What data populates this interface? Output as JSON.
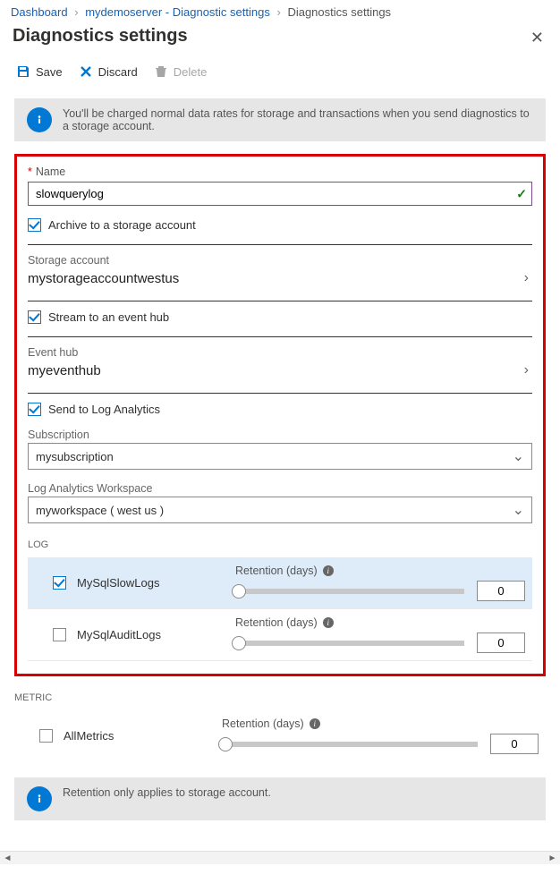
{
  "breadcrumb": {
    "items": [
      "Dashboard",
      "mydemoserver - Diagnostic settings",
      "Diagnostics settings"
    ]
  },
  "page_title": "Diagnostics settings",
  "toolbar": {
    "save": "Save",
    "discard": "Discard",
    "delete": "Delete"
  },
  "info_top": "You'll be charged normal data rates for storage and transactions when you send diagnostics to a storage account.",
  "name_field": {
    "label": "Name",
    "value": "slowquerylog"
  },
  "archive_chk": "Archive to a storage account",
  "storage_account": {
    "label": "Storage account",
    "value": "mystorageaccountwestus"
  },
  "stream_chk": "Stream to an event hub",
  "event_hub": {
    "label": "Event hub",
    "value": "myeventhub"
  },
  "log_analytics_chk": "Send to Log Analytics",
  "subscription": {
    "label": "Subscription",
    "value": "mysubscription"
  },
  "workspace": {
    "label": "Log Analytics Workspace",
    "value": "myworkspace ( west us )"
  },
  "section_log": "LOG",
  "logs": [
    {
      "name": "MySqlSlowLogs",
      "checked": true,
      "retention_label": "Retention (days)",
      "retention": "0"
    },
    {
      "name": "MySqlAuditLogs",
      "checked": false,
      "retention_label": "Retention (days)",
      "retention": "0"
    }
  ],
  "section_metric": "METRIC",
  "metrics": [
    {
      "name": "AllMetrics",
      "checked": false,
      "retention_label": "Retention (days)",
      "retention": "0"
    }
  ],
  "info_bottom": "Retention only applies to storage account."
}
